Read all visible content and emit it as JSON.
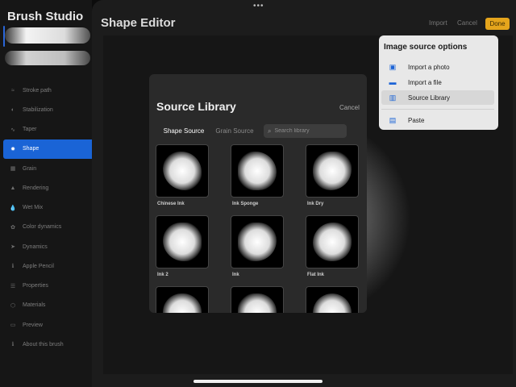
{
  "app": {
    "title": "Brush Studio"
  },
  "sidebar": {
    "items": [
      {
        "label": "Stroke path",
        "icon": "stroke-path-icon",
        "glyph": "≈"
      },
      {
        "label": "Stabilization",
        "icon": "stabilization-icon",
        "glyph": "◐"
      },
      {
        "label": "Taper",
        "icon": "taper-icon",
        "glyph": "∿"
      },
      {
        "label": "Shape",
        "icon": "shape-icon",
        "glyph": "✹",
        "active": true
      },
      {
        "label": "Grain",
        "icon": "grain-icon",
        "glyph": "▦"
      },
      {
        "label": "Rendering",
        "icon": "rendering-icon",
        "glyph": "▲"
      },
      {
        "label": "Wet Mix",
        "icon": "wet-mix-icon",
        "glyph": "💧"
      },
      {
        "label": "Color dynamics",
        "icon": "color-dynamics-icon",
        "glyph": "✿"
      },
      {
        "label": "Dynamics",
        "icon": "dynamics-icon",
        "glyph": "➤"
      },
      {
        "label": "Apple Pencil",
        "icon": "apple-pencil-icon",
        "glyph": "ℹ"
      },
      {
        "label": "Properties",
        "icon": "properties-icon",
        "glyph": "☰"
      },
      {
        "label": "Materials",
        "icon": "materials-icon",
        "glyph": "⬡"
      },
      {
        "label": "Preview",
        "icon": "preview-icon",
        "glyph": "▭"
      },
      {
        "label": "About this brush",
        "icon": "about-icon",
        "glyph": "ℹ"
      }
    ]
  },
  "editor": {
    "title": "Shape Editor",
    "import_label": "Import",
    "cancel_label": "Cancel",
    "done_label": "Done"
  },
  "import_menu": {
    "title": "Image source options",
    "options": [
      {
        "label": "Import a photo",
        "icon": "photo-icon",
        "glyph": "▣"
      },
      {
        "label": "Import a file",
        "icon": "folder-icon",
        "glyph": "▬"
      },
      {
        "label": "Source Library",
        "icon": "library-icon",
        "glyph": "▥",
        "selected": true
      },
      {
        "label": "Paste",
        "icon": "paste-icon",
        "glyph": "▤"
      }
    ]
  },
  "source_library": {
    "title": "Source Library",
    "cancel_label": "Cancel",
    "tabs": [
      {
        "label": "Shape Source",
        "active": true
      },
      {
        "label": "Grain Source",
        "active": false
      }
    ],
    "search_placeholder": "Search library",
    "items": [
      {
        "label": "Chinese Ink"
      },
      {
        "label": "Ink Sponge"
      },
      {
        "label": "Ink Dry"
      },
      {
        "label": "Ink 2"
      },
      {
        "label": "Ink"
      },
      {
        "label": "Flat Ink"
      },
      {
        "label": ""
      },
      {
        "label": ""
      },
      {
        "label": ""
      }
    ]
  },
  "colors": {
    "accent_blue": "#1a64d6",
    "done_yellow": "#e5a51c",
    "menu_icon_blue": "#1b63d6"
  }
}
